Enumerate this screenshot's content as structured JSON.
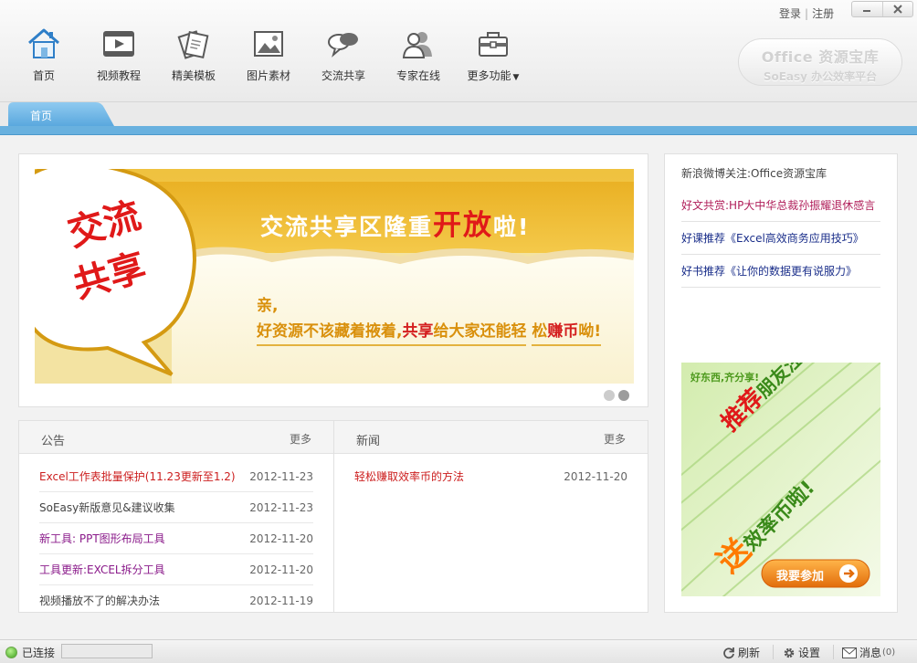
{
  "header": {
    "login": "登录",
    "register": "注册",
    "separator": "|",
    "nav": [
      {
        "label": "首页",
        "icon": "home-icon"
      },
      {
        "label": "视频教程",
        "icon": "video-icon"
      },
      {
        "label": "精美模板",
        "icon": "template-icon"
      },
      {
        "label": "图片素材",
        "icon": "picture-icon"
      },
      {
        "label": "交流共享",
        "icon": "chat-icon"
      },
      {
        "label": "专家在线",
        "icon": "experts-icon"
      },
      {
        "label": "更多功能",
        "icon": "toolbox-icon"
      }
    ],
    "logo_line1": "Office 资源宝库",
    "logo_line2": "SoEasy 办公效率平台"
  },
  "tabs": [
    {
      "label": "首页"
    }
  ],
  "banner": {
    "headline_part1": "交流共享区隆重",
    "headline_highlight": "开放",
    "headline_part2": "啦!",
    "bubble_line1": "交流",
    "bubble_line2": "共享",
    "sub1": "亲,",
    "sub2_part1": "好资源不该藏着掖着,",
    "sub2_highlight": "共享",
    "sub2_part2": "给大家还能轻",
    "sub3_part1": "松",
    "sub3_highlight": "赚币",
    "sub3_part2": "呦!"
  },
  "notice": {
    "title": "公告",
    "more": "更多",
    "items": [
      {
        "title": "Excel工作表批量保护(11.23更新至1.2)",
        "date": "2012-11-23",
        "color": "#cc1e1e"
      },
      {
        "title": "SoEasy新版意见&建议收集",
        "date": "2012-11-23",
        "color": "#444444"
      },
      {
        "title": "新工具: PPT图形布局工具",
        "date": "2012-11-20",
        "color": "#8a1a8a"
      },
      {
        "title": "工具更新:EXCEL拆分工具",
        "date": "2012-11-20",
        "color": "#8a1a8a"
      },
      {
        "title": "视频播放不了的解决办法",
        "date": "2012-11-19",
        "color": "#444444"
      }
    ]
  },
  "news": {
    "title": "新闻",
    "more": "更多",
    "items": [
      {
        "title": "轻松赚取效率币的方法",
        "date": "2012-11-20",
        "color": "#cc1e1e"
      }
    ]
  },
  "side": {
    "weibo": "新浪微博关注:Office资源宝库",
    "links": [
      {
        "label": "好文共赏:HP大中华总裁孙振耀退休感言",
        "color": "#b01e5a"
      },
      {
        "label": "好课推荐《Excel高效商务应用技巧》",
        "color": "#1a2e8a"
      },
      {
        "label": "好书推荐《让你的数据更有说服力》",
        "color": "#1a2e8a"
      }
    ],
    "promo": {
      "top": "好东西,齐分享!",
      "line1_highlight": "推荐",
      "line1_rest": "朋友注册,",
      "line2_highlight": "送",
      "line2_rest": "效率币啦!",
      "button": "我要参加"
    }
  },
  "status": {
    "connected": "已连接",
    "refresh": "刷新",
    "settings": "设置",
    "messages": "消息",
    "message_count": "(0)"
  },
  "colors": {
    "accent_blue": "#69b1df",
    "link_red": "#cc1e1e",
    "banner_orange": "#e8a81c"
  }
}
